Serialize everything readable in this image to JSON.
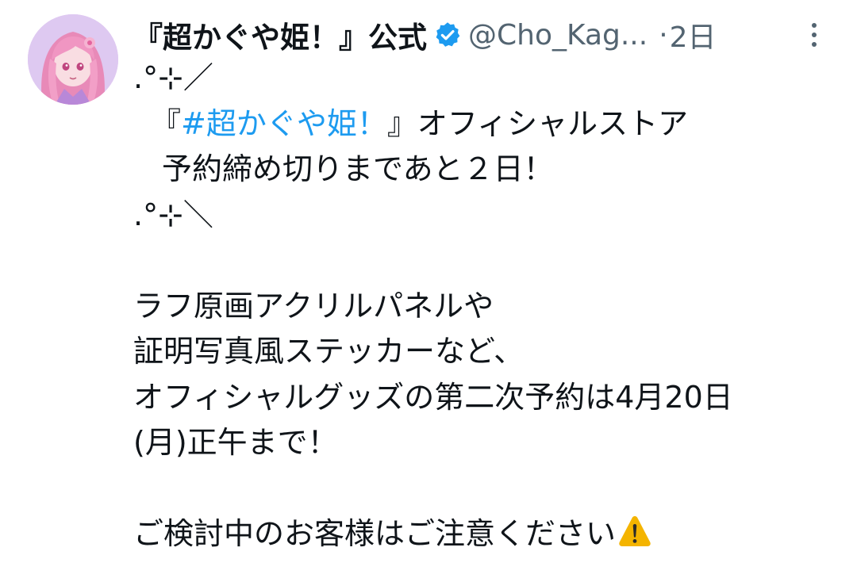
{
  "post": {
    "display_name": "『超かぐや姫！』公式",
    "handle": "@Cho_Kag...",
    "separator": "·",
    "time": "2日",
    "verified_color": "#1d9bf0",
    "hashtag_color": "#1d9bf0",
    "lines": {
      "deco_top": ".°⊹／",
      "l1_open": "『",
      "l1_hashtag": "#超かぐや姫！",
      "l1_rest": "』オフィシャルストア",
      "l2": "予約締め切りまであと２日！",
      "deco_bottom": ".°⊹＼",
      "l3": "ラフ原画アクリルパネルや",
      "l4": "証明写真風ステッカーなど、",
      "l5": "オフィシャルグッズの第二次予約は4月20日",
      "l6": "(月)正午まで！",
      "l7": "ご検討中のお客様はご注意ください"
    },
    "icons": {
      "verified": "verified-badge-icon",
      "more": "more-vertical-icon",
      "warning": "warning-emoji-icon"
    }
  }
}
